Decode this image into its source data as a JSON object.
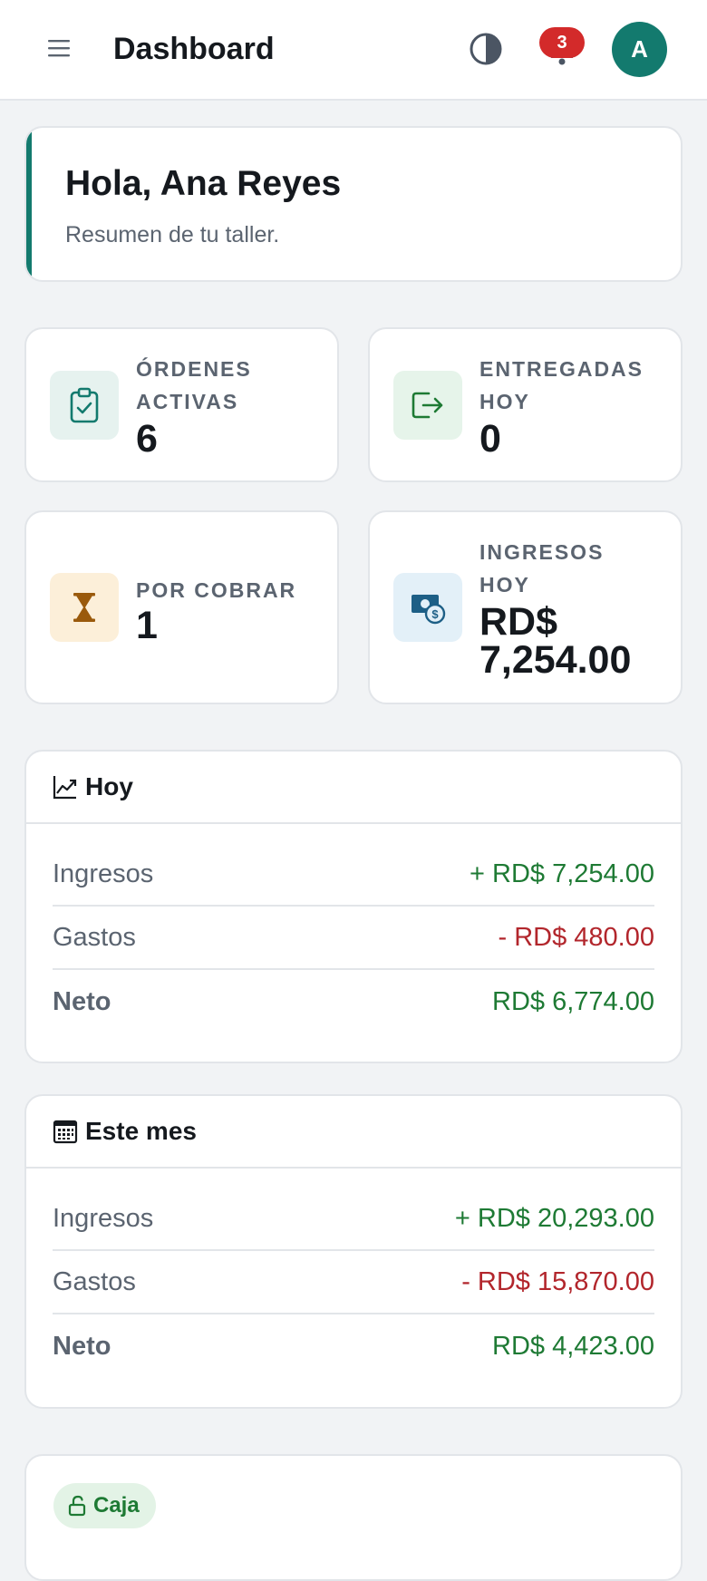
{
  "header": {
    "title": "Dashboard",
    "notifications_count": "3",
    "avatar_initial": "A",
    "accent_color": "#137a6e"
  },
  "greeting": {
    "title": "Hola, Ana Reyes",
    "subtitle": "Resumen de tu taller."
  },
  "stats": [
    {
      "label": "ÓRDENES ACTIVAS",
      "value": "6",
      "icon": "clipboard-check-icon",
      "color": "#137a6e"
    },
    {
      "label": "ENTREGADAS HOY",
      "value": "0",
      "icon": "exit-arrow-icon",
      "color": "#1e7a34"
    },
    {
      "label": "POR COBRAR",
      "value": "1",
      "icon": "hourglass-icon",
      "color": "#9a5a0c"
    },
    {
      "label": "INGRESOS HOY",
      "value": "RD$ 7,254.00",
      "icon": "cash-icon",
      "color": "#1d5f86"
    }
  ],
  "today": {
    "title": "Hoy",
    "icon": "trend-chart-icon",
    "rows": [
      {
        "label": "Ingresos",
        "value": "+ RD$ 7,254.00"
      },
      {
        "label": "Gastos",
        "value": "- RD$ 480.00"
      },
      {
        "label": "Neto",
        "value": "RD$ 6,774.00"
      }
    ]
  },
  "month": {
    "title": "Este mes",
    "icon": "calendar-icon",
    "rows": [
      {
        "label": "Ingresos",
        "value": "+ RD$ 20,293.00"
      },
      {
        "label": "Gastos",
        "value": "- RD$ 15,870.00"
      },
      {
        "label": "Neto",
        "value": "RD$ 4,423.00"
      }
    ]
  },
  "cash": {
    "label": "Caja",
    "icon": "unlock-icon"
  }
}
